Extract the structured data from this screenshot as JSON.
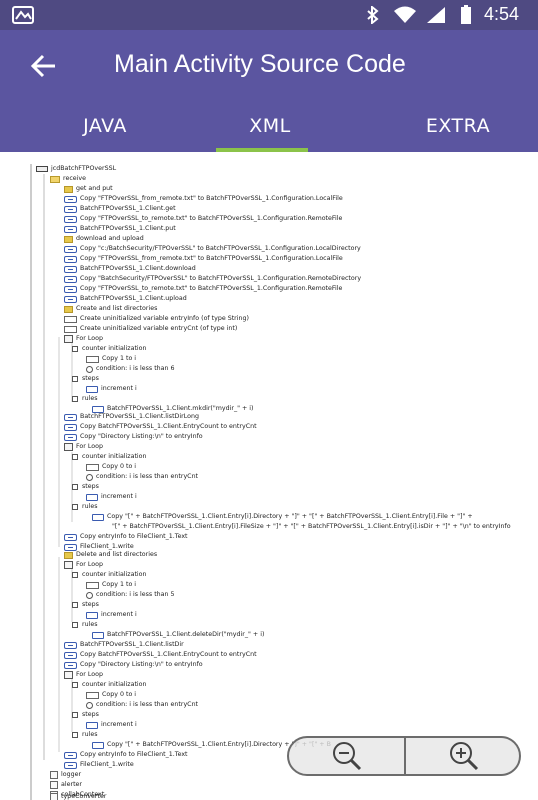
{
  "status_bar": {
    "time": "4:54",
    "icons": [
      "gallery-icon",
      "bluetooth-icon",
      "wifi-icon",
      "signal-icon",
      "battery-icon"
    ]
  },
  "app_bar": {
    "title": "Main Activity Source Code",
    "back_icon": "back-arrow-icon"
  },
  "tabs": [
    {
      "label": "JAVA",
      "selected": false
    },
    {
      "label": "XML",
      "selected": true
    },
    {
      "label": "EXTRA",
      "selected": false
    }
  ],
  "colors": {
    "status_bar": "#4f4a82",
    "app_bar": "#5b55a0",
    "tab_indicator": "#8bc34a"
  },
  "tree": [
    {
      "text": "jcdBatchFTPOverSSL",
      "icon": "cls"
    },
    {
      "text": "receive",
      "icon": "folder"
    },
    {
      "text": "get and put",
      "icon": "note"
    },
    {
      "text": "Copy \"FTPOverSSL_from_remote.txt\" to BatchFTPOverSSL_1.Configuration.LocalFile",
      "icon": "cp"
    },
    {
      "text": "BatchFTPOverSSL_1.Client.get",
      "icon": "cp"
    },
    {
      "text": "Copy \"FTPOverSSL_to_remote.txt\" to BatchFTPOverSSL_1.Configuration.RemoteFile",
      "icon": "cp"
    },
    {
      "text": "BatchFTPOverSSL_1.Client.put",
      "icon": "cp"
    },
    {
      "text": "download and upload",
      "icon": "note"
    },
    {
      "text": "Copy \"c:/BatchSecurity/FTPOverSSL\" to BatchFTPOverSSL_1.Configuration.LocalDirectory",
      "icon": "cp"
    },
    {
      "text": "Copy \"FTPOverSSL_from_remote.txt\" to BatchFTPOverSSL_1.Configuration.LocalFile",
      "icon": "cp"
    },
    {
      "text": "BatchFTPOverSSL_1.Client.download",
      "icon": "cp"
    },
    {
      "text": "Copy \"BatchSecurity/FTPOverSSL\" to BatchFTPOverSSL_1.Configuration.RemoteDirectory",
      "icon": "cp"
    },
    {
      "text": "Copy \"FTPOverSSL_to_remote.txt\" to BatchFTPOverSSL_1.Configuration.RemoteFile",
      "icon": "cp"
    },
    {
      "text": "BatchFTPOverSSL_1.Client.upload",
      "icon": "cp"
    },
    {
      "text": "Create and list directories",
      "icon": "note"
    },
    {
      "text": "Create uninitialized variable entryInfo (of type String)",
      "icon": "var"
    },
    {
      "text": "Create uninitialized variable entryCnt (of type int)",
      "icon": "var"
    },
    {
      "text": "For Loop",
      "icon": "loop"
    },
    {
      "text": "counter initialization",
      "icon": "tog"
    },
    {
      "text": "Copy 1 to i",
      "icon": "var"
    },
    {
      "text": "condition: i is less than 6",
      "icon": "cond"
    },
    {
      "text": "steps",
      "icon": "tog"
    },
    {
      "text": "increment i",
      "icon": "arrow"
    },
    {
      "text": "rules",
      "icon": "tog"
    },
    {
      "text": "BatchFTPOverSSL_1.Client.mkdir(\"mydir_\" + i)",
      "icon": "arrow"
    },
    {
      "text": "BatchFTPOverSSL_1.Client.listDirLong",
      "icon": "cp"
    },
    {
      "text": "Copy BatchFTPOverSSL_1.Client.EntryCount to entryCnt",
      "icon": "cp"
    },
    {
      "text": "Copy \"Directory Listing:\\n\" to entryInfo",
      "icon": "cp"
    },
    {
      "text": "For Loop",
      "icon": "loop"
    },
    {
      "text": "counter initialization",
      "icon": "tog"
    },
    {
      "text": "Copy 0 to i",
      "icon": "var"
    },
    {
      "text": "condition: i is less than entryCnt",
      "icon": "cond"
    },
    {
      "text": "steps",
      "icon": "tog"
    },
    {
      "text": "increment i",
      "icon": "arrow"
    },
    {
      "text": "rules",
      "icon": "tog"
    },
    {
      "text": "Copy \"[\" + BatchFTPOverSSL_1.Client.Entry[i].Directory + \"]\" + \"[\" + BatchFTPOverSSL_1.Client.Entry[i].File + \"]\" +",
      "icon": "arrow"
    },
    {
      "text": "\"[\" + BatchFTPOverSSL_1.Client.Entry[i].FileSize + \"]\" + \"[\" + BatchFTPOverSSL_1.Client.Entry[i].isDir + \"]\" + \"\\n\" to entryInfo",
      "icon": "none"
    },
    {
      "text": "Copy entryInfo to FileClient_1.Text",
      "icon": "cp"
    },
    {
      "text": "FileClient_1.write",
      "icon": "cp"
    },
    {
      "text": "Delete and list directories",
      "icon": "note"
    },
    {
      "text": "For Loop",
      "icon": "loop"
    },
    {
      "text": "counter initialization",
      "icon": "tog"
    },
    {
      "text": "Copy 1 to i",
      "icon": "var"
    },
    {
      "text": "condition: i is less than 5",
      "icon": "cond"
    },
    {
      "text": "steps",
      "icon": "tog"
    },
    {
      "text": "increment i",
      "icon": "arrow"
    },
    {
      "text": "rules",
      "icon": "tog"
    },
    {
      "text": "BatchFTPOverSSL_1.Client.deleteDir(\"mydir_\" + i)",
      "icon": "arrow"
    },
    {
      "text": "BatchFTPOverSSL_1.Client.listDir",
      "icon": "cp"
    },
    {
      "text": "Copy BatchFTPOverSSL_1.Client.EntryCount to entryCnt",
      "icon": "cp"
    },
    {
      "text": "Copy \"Directory Listing:\\n\" to entryInfo",
      "icon": "cp"
    },
    {
      "text": "For Loop",
      "icon": "loop"
    },
    {
      "text": "counter initialization",
      "icon": "tog"
    },
    {
      "text": "Copy 0 to i",
      "icon": "var"
    },
    {
      "text": "condition: i is less than entryCnt",
      "icon": "cond"
    },
    {
      "text": "steps",
      "icon": "tog"
    },
    {
      "text": "increment i",
      "icon": "arrow"
    },
    {
      "text": "rules",
      "icon": "tog"
    },
    {
      "text": "Copy \"[\" + BatchFTPOverSSL_1.Client.Entry[i].Directory + \"]\" + \"[\" + B",
      "icon": "arrow"
    },
    {
      "text": "Copy entryInfo to FileClient_1.Text",
      "icon": "cp"
    },
    {
      "text": "FileClient_1.write",
      "icon": "cp"
    },
    {
      "text": "logger",
      "icon": "box"
    },
    {
      "text": "alerter",
      "icon": "box"
    },
    {
      "text": "collabContext",
      "icon": "box"
    },
    {
      "text": "typeConverter",
      "icon": "box"
    }
  ],
  "zoom": {
    "zoom_out_icon": "zoom-out-icon",
    "zoom_in_icon": "zoom-in-icon"
  }
}
